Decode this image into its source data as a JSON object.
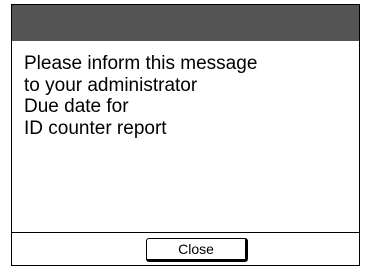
{
  "dialog": {
    "message_lines": [
      "Please inform this message",
      "to your administrator",
      "Due date for",
      "ID counter report"
    ],
    "close_label": "Close"
  },
  "colors": {
    "title_bar": "#555555",
    "border": "#000000",
    "background": "#ffffff",
    "text": "#000000"
  }
}
